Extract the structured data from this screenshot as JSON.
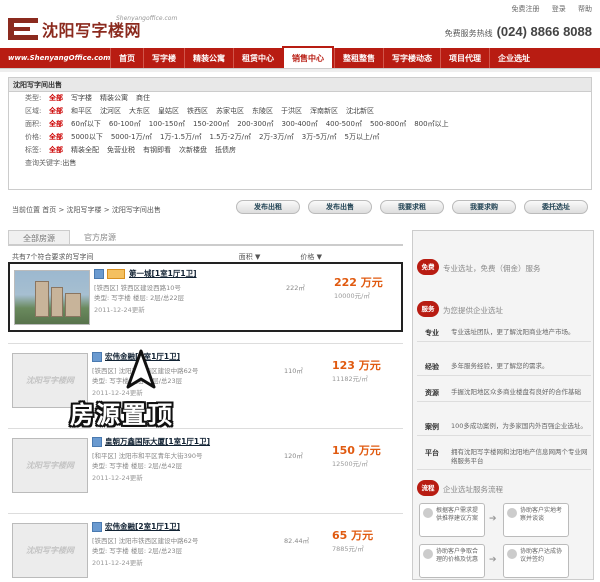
{
  "toplinks": [
    "免费注册",
    "登录",
    "帮助"
  ],
  "logo": {
    "title": "沈阳写字楼网",
    "domain": "Shenyangoffice.com"
  },
  "hotline": {
    "label": "免费服务热线",
    "number": "(024) 8866 8088"
  },
  "nav": {
    "domain": "www.ShenyangOffice.com",
    "items": [
      {
        "label": "首页"
      },
      {
        "label": "写字楼"
      },
      {
        "label": "精装公寓"
      },
      {
        "label": "租赁中心"
      },
      {
        "label": "销售中心",
        "active": true
      },
      {
        "label": "整租整售"
      },
      {
        "label": "写字楼动态"
      },
      {
        "label": "项目代理"
      },
      {
        "label": "企业选址"
      }
    ]
  },
  "filter": {
    "title": "沈阳写字间出售",
    "rows": [
      {
        "label": "类型:",
        "options": [
          "全部",
          "写字楼",
          "精装公寓",
          "商住"
        ]
      },
      {
        "label": "区域:",
        "options": [
          "全部",
          "和平区",
          "沈河区",
          "大东区",
          "皇姑区",
          "铁西区",
          "苏家屯区",
          "东陵区",
          "于洪区",
          "浑南新区",
          "沈北新区"
        ]
      },
      {
        "label": "面积:",
        "options": [
          "全部",
          "60㎡以下",
          "60-100㎡",
          "100-150㎡",
          "150-200㎡",
          "200-300㎡",
          "300-400㎡",
          "400-500㎡",
          "500-800㎡",
          "800㎡以上"
        ]
      },
      {
        "label": "价格:",
        "options": [
          "全部",
          "5000以下",
          "5000-1万/㎡",
          "1万-1.5万/㎡",
          "1.5万-2万/㎡",
          "2万-3万/㎡",
          "3万-5万/㎡",
          "5万以上/㎡"
        ]
      },
      {
        "label": "标签:",
        "options": [
          "全部",
          "精装全配",
          "免营业税",
          "有钢即看",
          "次新楼盘",
          "抵债房"
        ]
      },
      {
        "label": "查询关键字:",
        "options": [
          "出售"
        ]
      }
    ]
  },
  "breadcrumb": "当前位置 首页 > 沈阳写字楼 > 沈阳写字间出售",
  "action_buttons": [
    "发布出租",
    "发布出售",
    "我要求租",
    "我要求购",
    "委托选址"
  ],
  "tabs": [
    "全部房源",
    "官方房源"
  ],
  "list": {
    "summary": "共有7个符合要求的写字间",
    "sort_area": "面积",
    "sort_price": "价格",
    "items": [
      {
        "name": "第一城[1室1厅1卫]",
        "addr": "[铁西区] 铁西区建设西路10号",
        "type": "类型: 写字楼  楼层: 2层/总22层",
        "date": "2011-12-24更新",
        "area": "222㎡",
        "price": "222 万元",
        "unit": "10000元/㎡"
      },
      {
        "name": "宏伟金融[1室1厅1卫]",
        "addr": "[铁西区] 沈阳市铁西区建设中路62号",
        "type": "类型: 写字楼  楼层: 2层/总23层",
        "date": "2011-12-24更新",
        "area": "110㎡",
        "price": "123 万元",
        "unit": "11182元/㎡"
      },
      {
        "name": "皇朝万鑫国际大厦[1室1厅1卫]",
        "addr": "[和平区] 沈阳市和平区青年大街390号",
        "type": "类型: 写字楼  楼层: 2层/总42层",
        "date": "2011-12-24更新",
        "area": "120㎡",
        "price": "150 万元",
        "unit": "12500元/㎡"
      },
      {
        "name": "宏伟金融[2室1厅1卫]",
        "addr": "[铁西区] 沈阳市铁西区建设中路62号",
        "type": "类型: 写字楼  楼层: 2层/总23层",
        "date": "2011-12-24更新",
        "area": "82.44㎡",
        "price": "65 万元",
        "unit": "7885元/㎡"
      }
    ],
    "placeholder_logo": "沈阳写字楼网"
  },
  "annotation": "房源置顶",
  "sidebar": {
    "free": {
      "badge": "免费",
      "title": "专业选址，免费（佣金）服务"
    },
    "service": {
      "badge": "服务",
      "title": "为您提供企业选址"
    },
    "rows": [
      {
        "k": "专业",
        "v": "专业选址团队，更了解沈阳商业地产市场。"
      },
      {
        "k": "经验",
        "v": "多年服务经验，更了解您的需求。"
      },
      {
        "k": "资源",
        "v": "手握沈阳地区众多商业楼盘有良好的合作基础"
      },
      {
        "k": "案例",
        "v": "100多成功案例，为多家国内外百强企业选址。"
      },
      {
        "k": "平台",
        "v": "拥有沈阳写字楼网和沈阳地产信息网两个专业网络服务平台"
      }
    ],
    "process": {
      "badge": "流程",
      "title": "企业选址服务流程"
    },
    "steps": [
      "根据客户需求提供推荐建议方案",
      "协助客户实地考察并谈谈",
      "协助客户争取合理的价格及优惠",
      "协助客户达成协议并签约"
    ]
  }
}
